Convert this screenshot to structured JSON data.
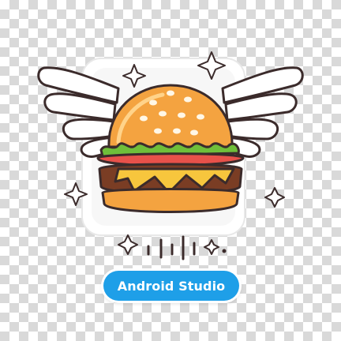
{
  "badge": {
    "label": "Android Studio",
    "color": "#1e9fe8",
    "text_color": "#ffffff"
  },
  "sticker": {
    "subject": "winged-burger-icon",
    "sparkles": [
      "sparkle-icon",
      "sparkle-icon",
      "sparkle-icon",
      "sparkle-icon",
      "sparkle-icon"
    ]
  },
  "colors": {
    "bun": "#f4a340",
    "bun_shadow": "#e0862a",
    "lettuce": "#6fbf3a",
    "tomato": "#e8514a",
    "cheese": "#f7c63d",
    "patty": "#7a3d24",
    "wing": "#ffffff",
    "outline": "#3b2b2b"
  }
}
